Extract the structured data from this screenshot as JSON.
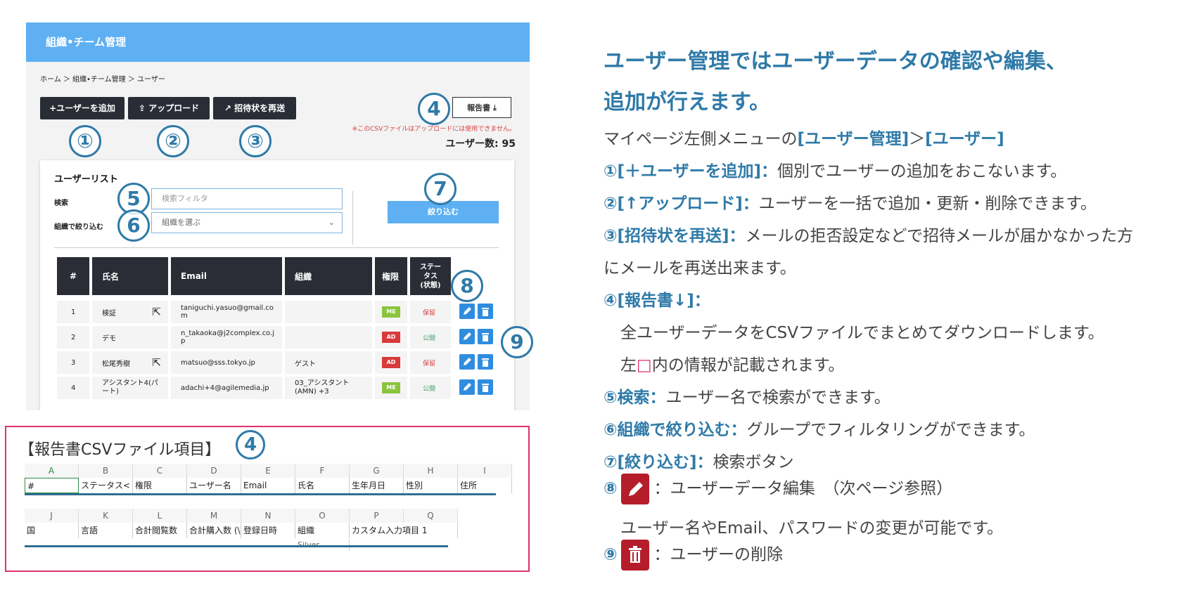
{
  "app": {
    "header_title": "組織•チーム管理",
    "breadcrumb": "ホーム ＞ 組織•チーム管理 ＞ ユーザー",
    "buttons": {
      "add_user": "+ユーザーを追加",
      "upload": "アップロード",
      "resend_invite": "招待状を再送",
      "report": "報告書"
    },
    "csv_note": "※このCSVファイルはアップロードには使用できません。",
    "user_count": "ユーザー数: 95",
    "list": {
      "title": "ユーザーリスト",
      "search_label": "検索",
      "search_placeholder": "検索フィルタ",
      "org_label": "組織で絞り込む",
      "org_placeholder": "組織を選ぶ",
      "filter_button": "絞り込む"
    },
    "table": {
      "headers": [
        "#",
        "氏名",
        "Email",
        "組織",
        "権限",
        "ステータス(状態)"
      ],
      "header_status_lines": [
        "ステー",
        "タス",
        "(状態)"
      ],
      "rows": [
        {
          "num": "1",
          "name": "検証",
          "email": "taniguchi.yasuo@gmail.com",
          "org": "",
          "role": "ME",
          "status": "保留"
        },
        {
          "num": "2",
          "name": "デモ",
          "email": "n_takaoka@j2complex.co.jp",
          "org": "",
          "role": "AD",
          "status": "公開"
        },
        {
          "num": "3",
          "name": "松尾秀樹",
          "email": "matsuo@sss.tokyo.jp",
          "org": "ゲスト",
          "role": "AD",
          "status": "保留"
        },
        {
          "num": "4",
          "name": "アシスタント4(パート)",
          "email": "adachi+4@agilemedia.jp",
          "org": "03_アシスタント(AMN) +3",
          "role": "ME",
          "status": "公開"
        }
      ]
    },
    "markers": [
      "①",
      "②",
      "③",
      "4",
      "5",
      "6",
      "7",
      "8",
      "9"
    ]
  },
  "csv": {
    "title": "【報告書CSVファイル項目】",
    "marker": "4",
    "row1_cols": [
      "A",
      "B",
      "C",
      "D",
      "E",
      "F",
      "G",
      "H",
      "I"
    ],
    "row1_values": [
      "#",
      "ステータス<",
      "権限",
      "ユーザー名",
      "Email",
      "氏名",
      "生年月日",
      "性別",
      "住所"
    ],
    "row2_cols": [
      "J",
      "K",
      "L",
      "M",
      "N",
      "O",
      "P",
      "Q"
    ],
    "row2_values": [
      "国",
      "言語",
      "合計閲覧数",
      "合計購入数 (\\",
      "登録日時",
      "組織",
      "カスタム入力項目 1",
      ""
    ],
    "row2_extra": "Silver"
  },
  "right": {
    "title_line1": "ユーザー管理ではユーザーデータの確認や編集、",
    "title_line2": "追加が行えます。",
    "menu_path_prefix": "マイページ左側メニューの",
    "menu_path_1": "[ユーザー管理]",
    "menu_path_sep": "＞",
    "menu_path_2": "[ユーザー]",
    "item1_label": "①[＋ユーザーを追加]：",
    "item1_text": "個別でユーザーの追加をおこないます。",
    "item2_label": "②[↑アップロード]：",
    "item2_text": "ユーザーを一括で追加・更新・削除できます。",
    "item3_label": "③[招待状を再送]：",
    "item3_text": "メールの拒否設定などで招待メールが届かなかった方",
    "item3_text2": "にメールを再送出来ます。",
    "item4_label": "④[報告書↓]：",
    "item4_text": "全ユーザーデータをCSVファイルでまとめてダウンロードします。",
    "item4_text2_a": "左",
    "item4_text2_box": "□",
    "item4_text2_b": "内の情報が記載されます。",
    "item5_label": "⑤検索：",
    "item5_text": "ユーザー名で検索ができます。",
    "item6_label": "⑥組織で絞り込む：",
    "item6_text": "グループでフィルタリングができます。",
    "item7_label": "⑦[絞り込む]：",
    "item7_text": "検索ボタン",
    "item8_label": "⑧",
    "item8_text": "：ユーザーデータ編集　（次ページ参照）",
    "item8_text2": "ユーザー名やEmail、パスワードの変更が可能です。",
    "item9_label": "⑨",
    "item9_text": "：ユーザーの削除"
  },
  "colors": {
    "accent_blue": "#2f7aa8",
    "header_blue": "#5eb0f2",
    "dark": "#2a2c36",
    "badge_me": "#8ac43f",
    "badge_ad": "#d93a3a",
    "status_hold": "#d94040",
    "status_public": "#3aa06a",
    "delete_red": "#b51d2a",
    "border_pink": "#e0306a"
  }
}
